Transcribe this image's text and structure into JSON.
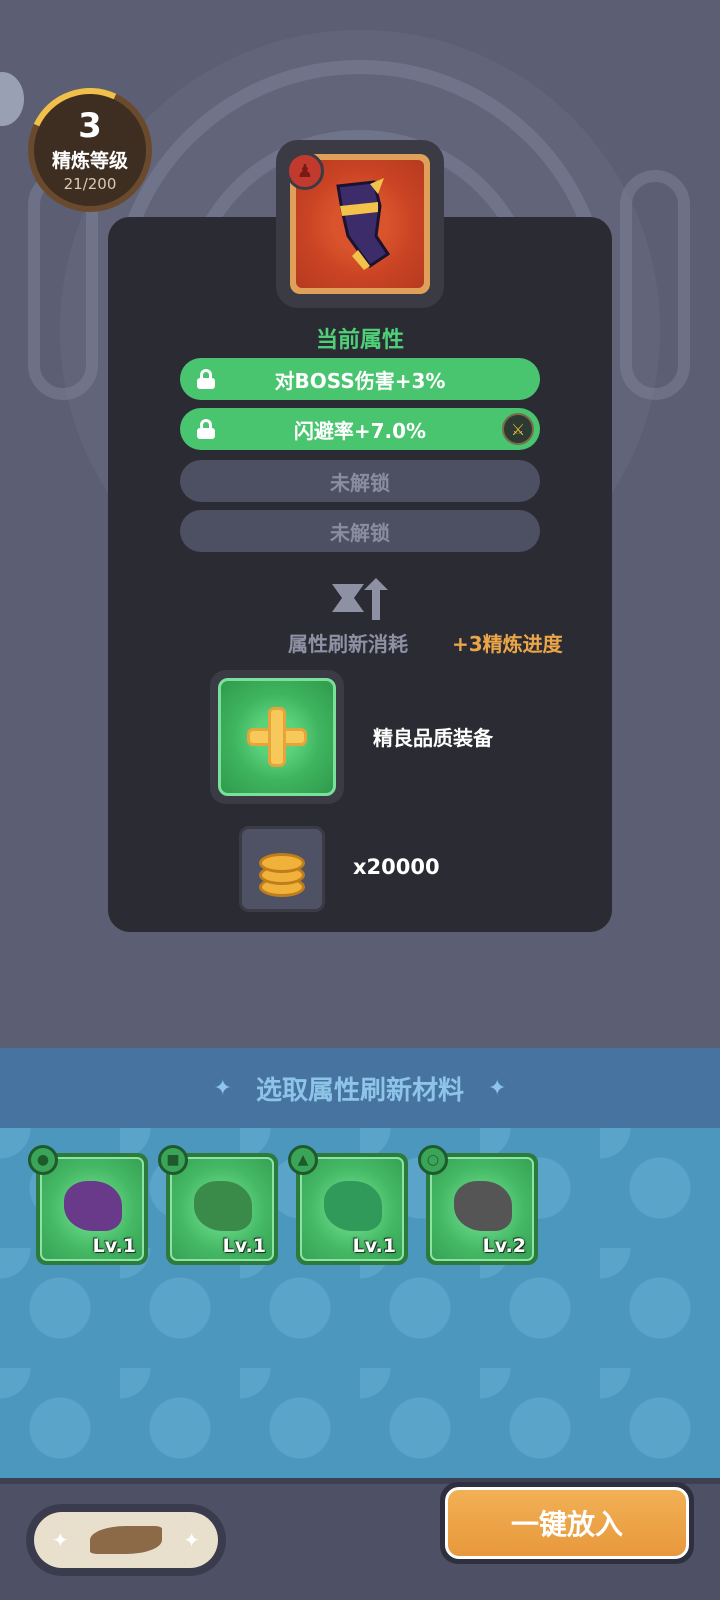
{
  "refine": {
    "level": "3",
    "label": "精炼等级",
    "progress": "21/200",
    "progress_fraction": 0.105
  },
  "equipment": {
    "icon": "gauntlet-icon",
    "rarity_color": "#d9542c"
  },
  "attributes": {
    "title": "当前属性",
    "items": [
      {
        "text": "对BOSS伤害+3%",
        "state": "unlocked"
      },
      {
        "text": "闪避率+7.0%",
        "state": "unlocked",
        "badge": "sword-icon"
      },
      {
        "text": "未解锁",
        "state": "locked"
      },
      {
        "text": "未解锁",
        "state": "locked"
      }
    ]
  },
  "cost": {
    "label": "属性刷新消耗",
    "value": "+3精炼进度",
    "material_label": "精良品质装备",
    "coin_count": "x20000"
  },
  "materials": {
    "title": "选取属性刷新材料",
    "items": [
      {
        "level": "Lv.1",
        "type_icon": "helmet-type-icon",
        "art_color": "#6a3a8a"
      },
      {
        "level": "Lv.1",
        "type_icon": "armor-type-icon",
        "art_color": "#3a8a4a"
      },
      {
        "level": "Lv.1",
        "type_icon": "shoulder-type-icon",
        "art_color": "#2f9a5a"
      },
      {
        "level": "Lv.2",
        "type_icon": "ring-type-icon",
        "art_color": "#555555"
      }
    ]
  },
  "actions": {
    "one_key": "一键放入"
  },
  "colors": {
    "accent_green": "#49c46f",
    "accent_orange": "#eaa54a",
    "panel": "#2b2c33"
  }
}
